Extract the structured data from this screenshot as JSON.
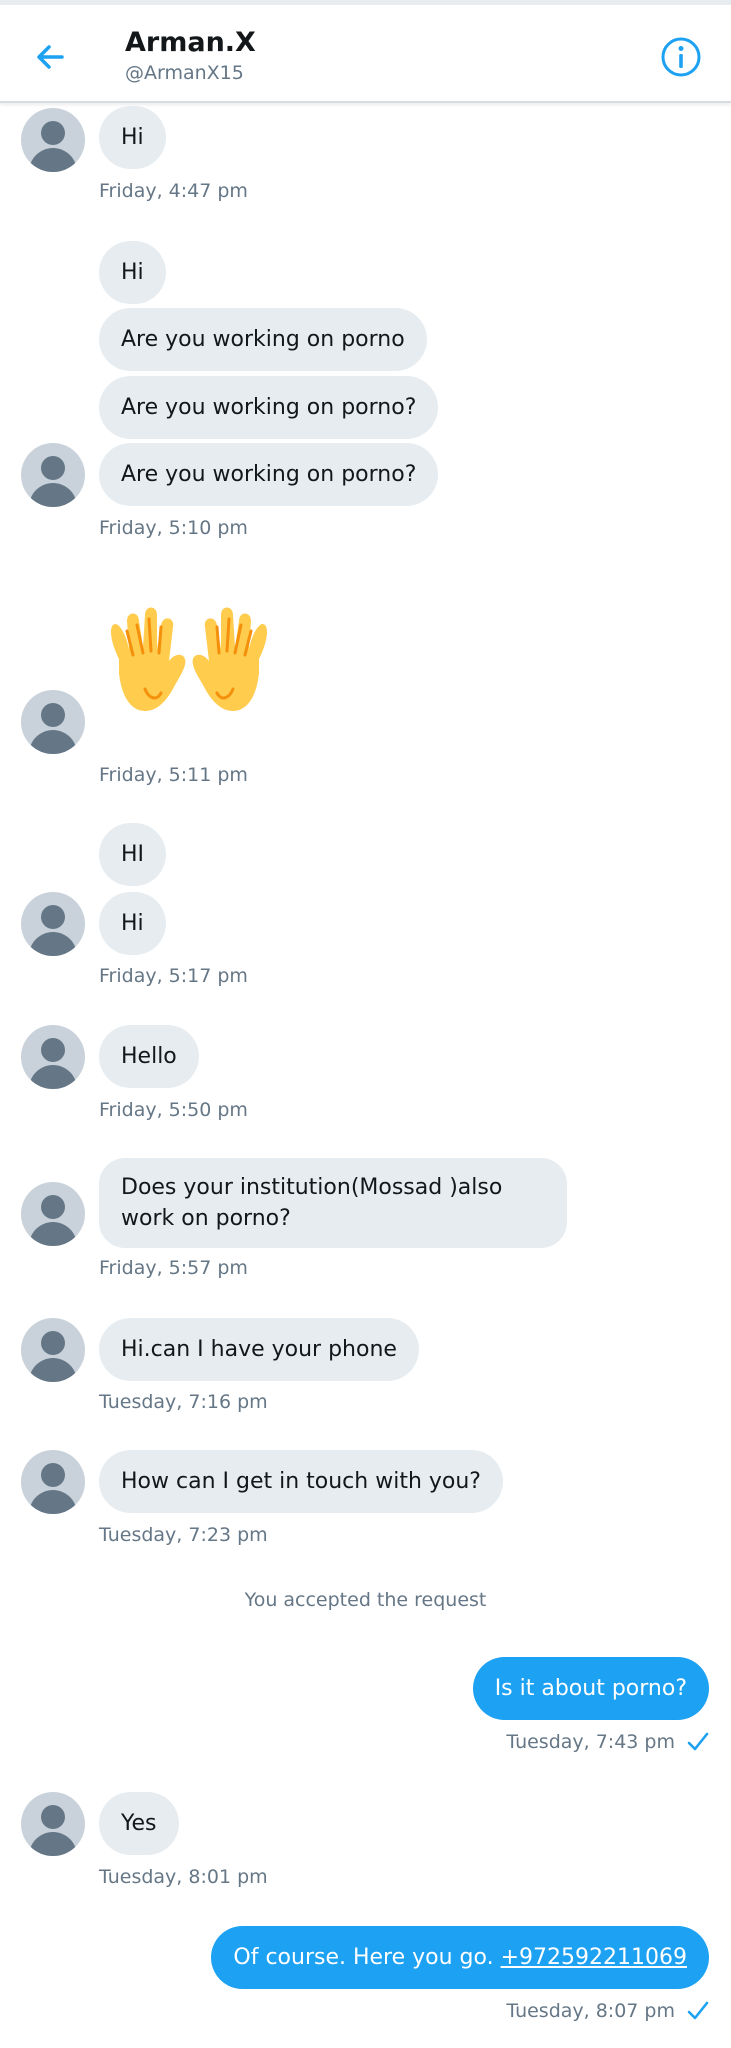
{
  "header": {
    "name": "Arman.X",
    "handle": "@ArmanX15",
    "back_icon": "arrow-left-icon",
    "info_icon": "info-icon",
    "accent": "#1da1f2"
  },
  "messages": [
    {
      "text": "Hi"
    },
    {
      "text": "Hi"
    },
    {
      "text": "Are you working on porno"
    },
    {
      "text": "Are you working on porno?"
    },
    {
      "text": "Are you working on porno?"
    },
    {
      "emoji": "raised-hands-emoji"
    },
    {
      "text": "HI"
    },
    {
      "text": "Hi"
    },
    {
      "text": "Hello"
    },
    {
      "text": "Does your institution(Mossad )also work on porno?"
    },
    {
      "text": "Hi.can I have your phone"
    },
    {
      "text": "How can I get in touch with you?"
    },
    {
      "text": "Is it about porno?"
    },
    {
      "text": "Yes"
    },
    {
      "text_prefix": "Of course. Here you go. ",
      "link": "+972592211069"
    }
  ],
  "timestamps": [
    "Friday, 4:47 pm",
    "Friday, 5:10 pm",
    "Friday, 5:11 pm",
    "Friday, 5:17 pm",
    "Friday, 5:50 pm",
    "Friday, 5:57 pm",
    "Tuesday, 7:16 pm",
    "Tuesday, 7:23 pm",
    "Tuesday, 7:43 pm",
    "Tuesday, 8:01 pm",
    "Tuesday, 8:07 pm"
  ],
  "system_message": "You accepted the request"
}
